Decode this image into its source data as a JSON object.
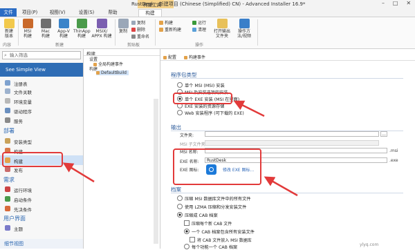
{
  "window": {
    "title": "RustDesk - 新建项目 (Chinese (Simplified) CN) - Advanced Installer 16.9*",
    "context_tab": "构建工具",
    "controls": [
      "–",
      "□",
      "✕"
    ]
  },
  "tabs": [
    {
      "label": "文件"
    },
    {
      "label": "项目(P)"
    },
    {
      "label": "视图(V)"
    },
    {
      "label": "设置(S)"
    },
    {
      "label": "帮助"
    },
    {
      "label": "构建"
    }
  ],
  "ribbon": {
    "new_build": "新建\n版本",
    "msi_build": "MSI\n构建",
    "mac_build": "Mac\n构建",
    "appv_build": "App-V\n构建",
    "thinapp_build": "ThinApp\n构建",
    "msix_build": "MSIX/\nAPPX 构建",
    "group_build": "新建",
    "group_project": "内容",
    "copy": "复制",
    "copy_small": "复制",
    "delete_small": "删除",
    "rename_small": "重命名",
    "group_clipboard": "剪贴板",
    "build_small": "构建",
    "rebuild_small": "重新构建",
    "run_small": "运行",
    "clean_small": "清理",
    "open_output": "打开输出\n文件夹",
    "report": "操作方\n法/视频",
    "group_ops": "操作"
  },
  "left": {
    "search_placeholder": "输入筛选",
    "simple_view": "See Simple View",
    "items_top": [
      "注册表",
      "文件关联",
      "环境变量",
      "驱动程序",
      "服务"
    ],
    "section_deploy": "部署",
    "items_deploy": [
      "安装类型",
      "构建",
      "发布"
    ],
    "section_requirements": "需求",
    "items_req": [
      "运行环境",
      "启动条件",
      "先决条件"
    ],
    "section_ui": "用户界面",
    "items_ui": [
      "主题"
    ],
    "status": "细节视图"
  },
  "middle": {
    "header": "构建",
    "tree": [
      "设置",
      "全局构建事件",
      "构建",
      "DefaultBuild"
    ]
  },
  "right": {
    "tabs": [
      "配置",
      "构建事件"
    ],
    "package_type": {
      "title": "程序包类型",
      "options": [
        "单个 MSI (MSI) 安装",
        "MSI 及安装选项的安装",
        "单个 EXE 安装 (MSI 在里面)",
        "EXE 安装的资源存储",
        "Web 安装程序 (可下载的 EXE)"
      ],
      "selected_index": 2
    },
    "output": {
      "title": "输出",
      "folder_label": "文件夹:",
      "msi_dir_label": "MSI 子文件夹:",
      "msi_name_label": "MSI 名称:",
      "msi_suffix": ".msi",
      "exe_name_label": "EXE 名称:",
      "exe_name_value": "RustDesk",
      "exe_suffix": ".exe",
      "exe_icon_label": "EXE 图标:",
      "exe_icon_link": "修改 EXE 图标..."
    },
    "files": {
      "title": "档案",
      "options": [
        "压缩 MSI 数据库文件中的所有文件",
        "使用 LZMA 压缩和分发安装文件",
        "压缩成 CAB 档案"
      ],
      "selected_index": 2,
      "sub_check": "压缩每个新 CAB 文件",
      "sub_radio": "一个 CAB 档案包含所有安装文件",
      "sub_check2": "将 CAB 文件放入 MSI 数据库",
      "last_radio": "每个功能一个 CAB 档案"
    }
  },
  "watermark": "ylyq.com",
  "colors": {
    "accent": "#2f6db5",
    "highlight": "#e23a3a",
    "file_tab": "#2b6cc4"
  }
}
